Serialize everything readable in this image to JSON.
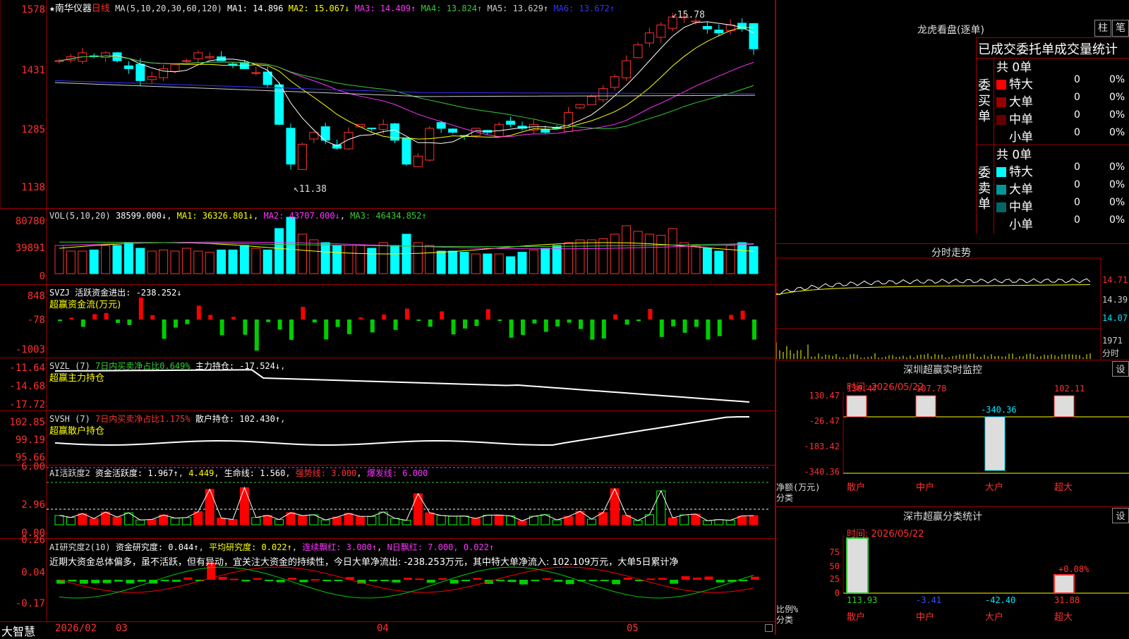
{
  "main": {
    "name": "★南华仪器",
    "period": "日线",
    "ma_label": "MA(5,10,20,30,60,120)",
    "ma": [
      {
        "k": "MA1:",
        "v": "14.896",
        "c": "#ffffff"
      },
      {
        "k": "MA2:",
        "v": "15.067↓",
        "c": "#ffff00"
      },
      {
        "k": "MA3:",
        "v": "14.409↑",
        "c": "#ff33ff"
      },
      {
        "k": "MA4:",
        "v": "13.824↑",
        "c": "#33cc33"
      },
      {
        "k": "MA5:",
        "v": "13.629↑",
        "c": "#cccccc"
      },
      {
        "k": "MA6:",
        "v": "13.672↑",
        "c": "#3333ff"
      }
    ],
    "yticks": [
      "15.78",
      "14.31",
      "12.85",
      "11.38"
    ],
    "yticks_display": [
      "1578",
      "1431",
      "1285",
      "1138"
    ],
    "high_label": "15.78",
    "low_label": "11.38"
  },
  "vol": {
    "title": "VOL(5,10,20)",
    "v0": "38599.000↓",
    "m1": "MA1: 36326.801↓",
    "m2": "MA2: 43707.000↓",
    "m3": "MA3: 46434.852↑",
    "yticks": [
      "80780",
      "39891",
      "0"
    ]
  },
  "svzj": {
    "title": "SVZJ  活跃资金进出: -238.252↓",
    "sub": "超赢资金流(万元)",
    "yticks": [
      "848",
      "-78",
      "-1003"
    ]
  },
  "svzl": {
    "title": "SVZL (7)",
    "t2": "7日内买卖净占比0.649%",
    "t3": "主力持仓: -17.524↓",
    "sub": "超赢主力持仓",
    "yticks": [
      "-11.64",
      "-14.68",
      "-17.72"
    ]
  },
  "svsh": {
    "title": "SVSH (7)",
    "t2": "7日内买卖净占比1.175%",
    "t3": "散户持仓: 102.430↑",
    "sub": "超赢散户持仓",
    "yticks": [
      "102.85",
      "99.19",
      "95.66"
    ]
  },
  "ai1": {
    "title": "AI活跃度2",
    "t2": "资金活跃度: 1.967↑",
    "t3": "4.449",
    "t4": "生命线: 1.560",
    "t5": "强势线: 3.000",
    "t6": "爆发线: 6.000",
    "yticks": [
      "6.00",
      "2.96",
      "0.00"
    ]
  },
  "ai2": {
    "title": "AI研究度2(10)",
    "t2": "资金研究度: 0.044↑",
    "t3": "平均研究度: 0.022↑",
    "t4": "连续飘红: 3.000↑",
    "t5": "N日飘红: 7.000, 0.022↑",
    "comment": "近期大资金总体偏多，虽不活跃，但有异动，宜关注大资金的持续性，今日大单净流出: -238.253万元，其中特大单净流入: 102.109万元，大单5日累计净",
    "yticks": [
      "0.26",
      "0.04",
      "-0.17"
    ]
  },
  "xaxis": {
    "brand": "大智慧",
    "labels": [
      "2026/02",
      "03",
      "04",
      "05"
    ]
  },
  "right": {
    "title": "龙虎看盘(逐单)",
    "btn1": "柱",
    "btn2": "笔",
    "tabs": "已成交委托单成交量统计",
    "buy_title": "委买单",
    "sell_title": "委卖单",
    "buy_count": "共 0单",
    "sell_count": "共 0单",
    "rows": [
      {
        "name": "特大",
        "v": "0",
        "p": "0%"
      },
      {
        "name": "大单",
        "v": "0",
        "p": "0%"
      },
      {
        "name": "中单",
        "v": "0",
        "p": "0%"
      },
      {
        "name": "小单",
        "v": "0",
        "p": "0%"
      }
    ],
    "intraday_title": "分时走势",
    "intraday_ticks": [
      "14.71",
      "14.39",
      "14.07",
      "1971",
      "分时"
    ],
    "monitor_title": "深圳超赢实时监控",
    "monitor_btn": "设",
    "monitor_time": "时间: 2026/05/22",
    "monitor_yticks": [
      "130.47",
      "-26.47",
      "-183.42",
      "-340.36"
    ],
    "monitor_ylabel1": "净额(万元)",
    "monitor_ylabel2": "分类",
    "monitor_vals": [
      "130.47",
      "107.78",
      "-340.36",
      "102.11"
    ],
    "cats": [
      "散户",
      "中户",
      "大户",
      "超大"
    ],
    "stat_title": "深市超赢分类统计",
    "stat_btn": "设",
    "stat_time": "时间: 2026/05/22",
    "stat_yticks": [
      "75",
      "50",
      "25",
      "0"
    ],
    "stat_ylabel1": "比例%",
    "stat_ylabel2": "分类",
    "stat_vals": [
      "113.93",
      "-3.41",
      "-42.40",
      "31.88"
    ],
    "stat_extra": "+0.08%"
  }
}
